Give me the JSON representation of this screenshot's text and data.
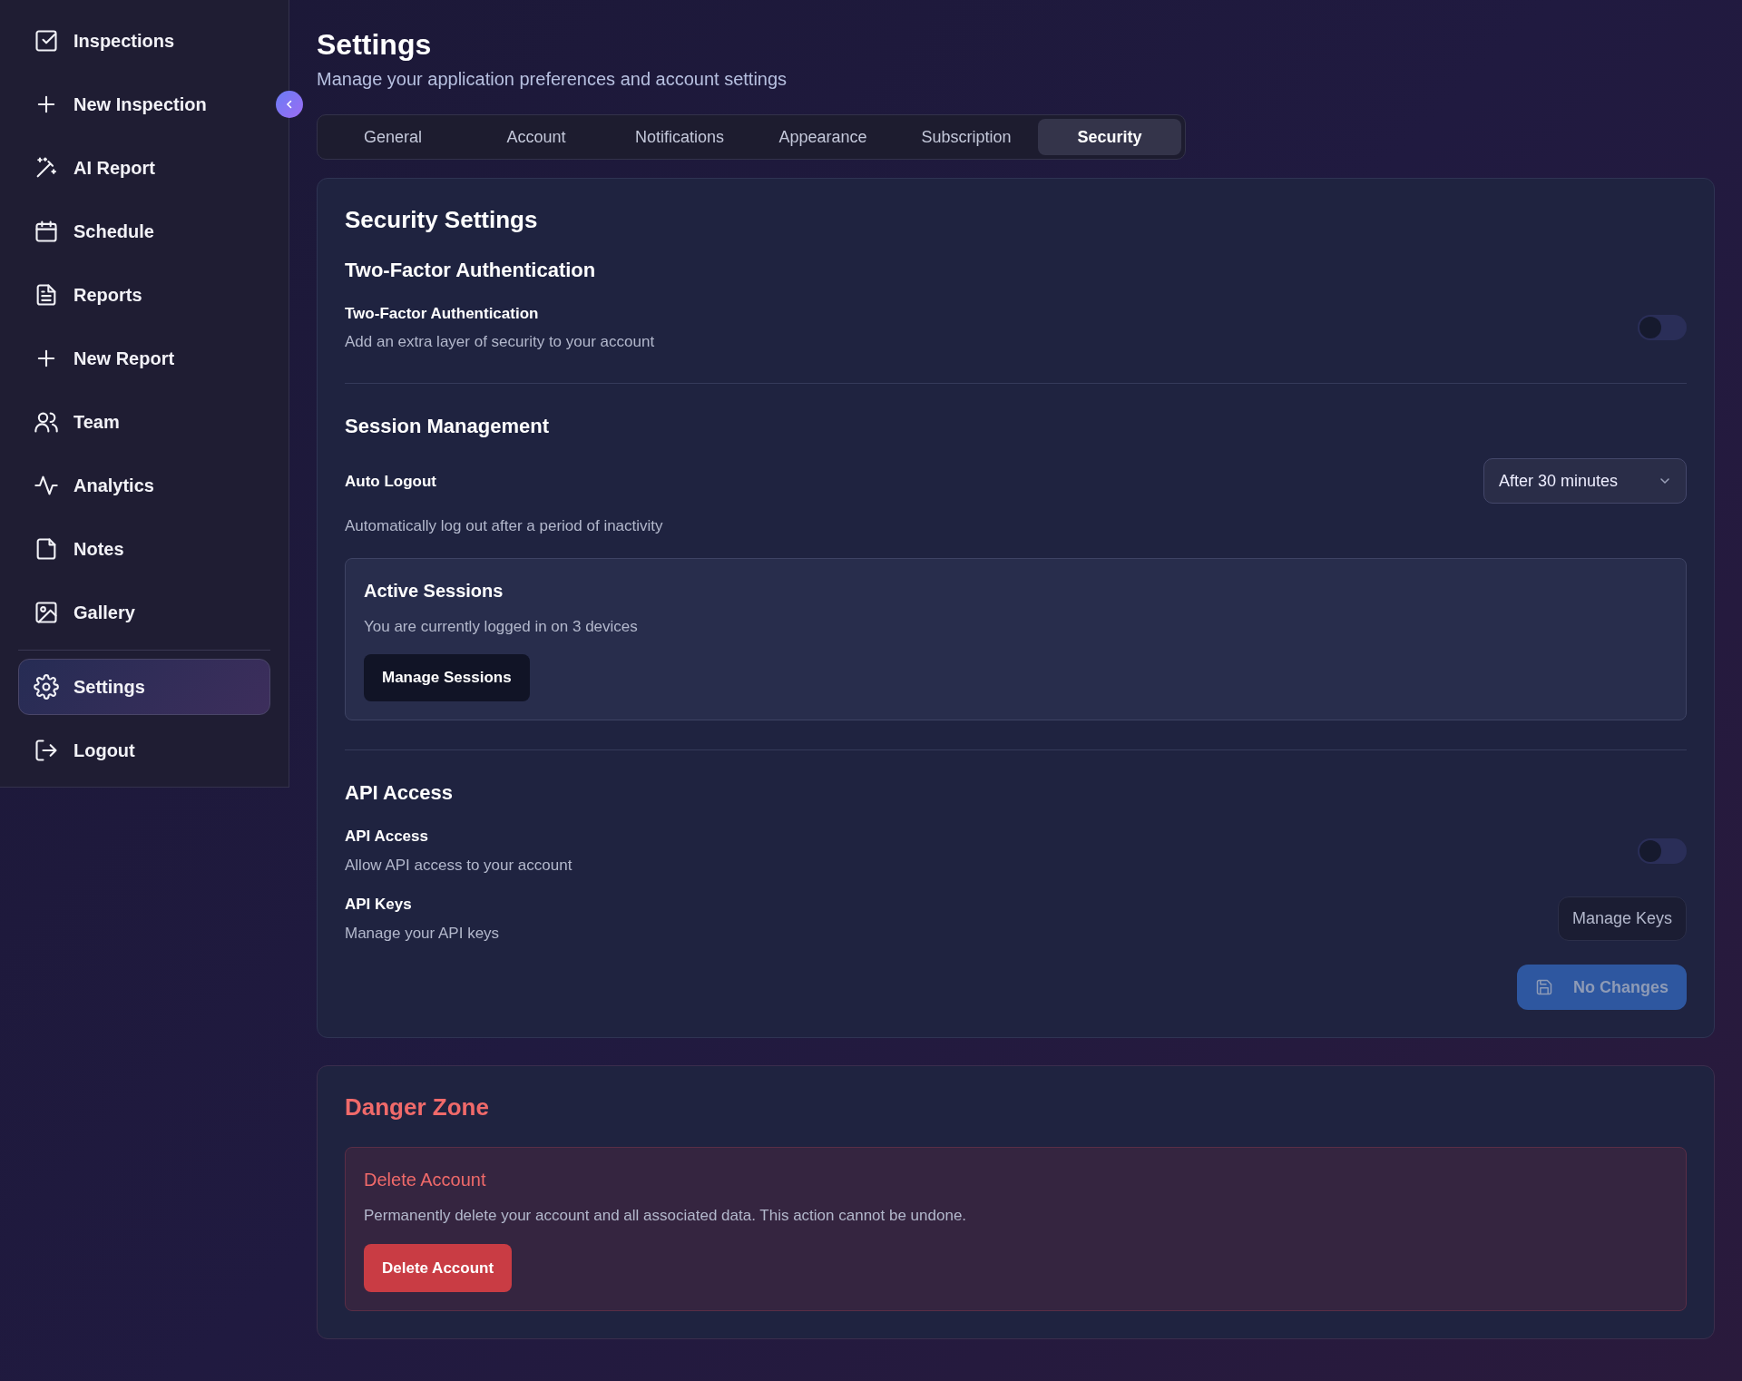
{
  "sidebar": {
    "items": [
      {
        "label": "Inspections",
        "selected": false
      },
      {
        "label": "New Inspection",
        "selected": false
      },
      {
        "label": "AI Report",
        "selected": false
      },
      {
        "label": "Schedule",
        "selected": false
      },
      {
        "label": "Reports",
        "selected": false
      },
      {
        "label": "New Report",
        "selected": false
      },
      {
        "label": "Team",
        "selected": false
      },
      {
        "label": "Analytics",
        "selected": false
      },
      {
        "label": "Notes",
        "selected": false
      },
      {
        "label": "Gallery",
        "selected": false
      }
    ],
    "footer_items": [
      {
        "label": "Settings",
        "selected": true
      },
      {
        "label": "Logout",
        "selected": false
      }
    ]
  },
  "page": {
    "title": "Settings",
    "subtitle": "Manage your application preferences and account settings"
  },
  "tabs": [
    {
      "label": "General",
      "selected": false
    },
    {
      "label": "Account",
      "selected": false
    },
    {
      "label": "Notifications",
      "selected": false
    },
    {
      "label": "Appearance",
      "selected": false
    },
    {
      "label": "Subscription",
      "selected": false
    },
    {
      "label": "Security",
      "selected": true
    }
  ],
  "security": {
    "title": "Security Settings",
    "two_factor": {
      "heading": "Two-Factor Authentication",
      "label": "Two-Factor Authentication",
      "description": "Add an extra layer of security to your account",
      "on": false
    },
    "session": {
      "heading": "Session Management",
      "label": "Auto Logout",
      "value": "After 30 minutes",
      "description": "Automatically log out after a period of inactivity",
      "active_sessions": {
        "title": "Active Sessions",
        "description": "You are currently logged in on 3 devices",
        "button": "Manage Sessions"
      }
    },
    "api": {
      "heading": "API Access",
      "label": "API Access",
      "description": "Allow API access to your account",
      "on": false,
      "keys_label": "API Keys",
      "keys_description": "Manage your API keys",
      "keys_button": "Manage Keys"
    },
    "save_button": {
      "label": "No Changes",
      "disabled": true
    }
  },
  "danger": {
    "title": "Danger Zone",
    "item_title": "Delete Account",
    "description": "Permanently delete your account and all associated data. This action cannot be undone.",
    "button": "Delete Account"
  }
}
